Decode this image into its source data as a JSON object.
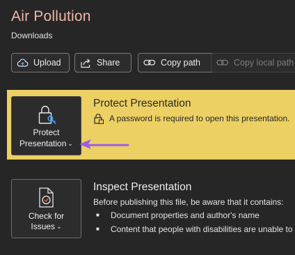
{
  "header": {
    "title": "Air Pollution",
    "location": "Downloads"
  },
  "actions": {
    "upload_label": "Upload",
    "share_label": "Share",
    "copy_path_label": "Copy path",
    "copy_local_path_label": "Copy local path"
  },
  "protect": {
    "tile_line1": "Protect",
    "tile_line2": "Presentation",
    "heading": "Protect Presentation",
    "message": "A password is required to open this presentation."
  },
  "inspect": {
    "tile_line1": "Check for",
    "tile_line2": "Issues",
    "heading": "Inspect Presentation",
    "description": "Before publishing this file, be aware that it contains:",
    "bullets": [
      "Document properties and author's name",
      "Content that people with disabilities are unable to"
    ]
  },
  "colors": {
    "background": "#262626",
    "highlight_band": "#ecd063",
    "title_accent": "#f1b7a6",
    "annotation_arrow": "#9b5de5"
  },
  "icons": {
    "upload": "cloud-upload-icon",
    "share": "share-icon",
    "copy_path": "link-icon",
    "copy_local_path": "link-icon",
    "protect": "lock-key-icon",
    "password_msg": "lock-document-icon",
    "check_issues": "document-check-icon",
    "bullet": "bullet-icon"
  }
}
